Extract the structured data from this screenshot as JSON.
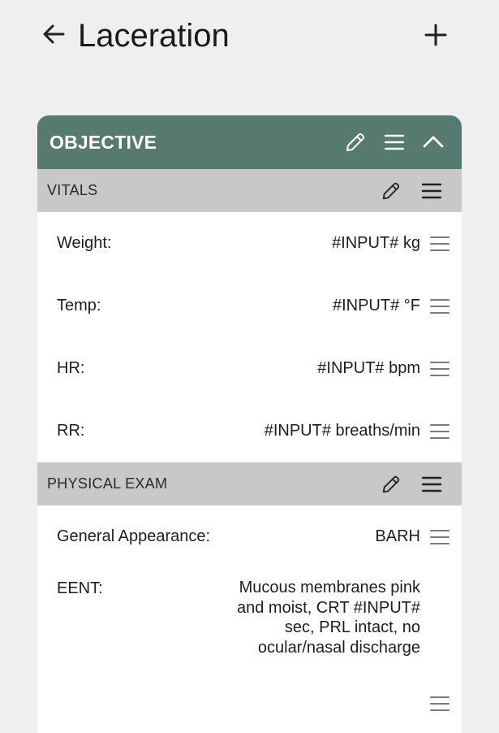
{
  "app_bar": {
    "title": "Laceration",
    "back_icon": "arrow-left-icon",
    "add_icon": "plus-icon"
  },
  "colors": {
    "background": "#efefef",
    "section_header": "#567a70",
    "subheader": "#c8c8c9",
    "card": "#ffffff",
    "icon": "#7a7a7a"
  },
  "section": {
    "title": "OBJECTIVE",
    "icons": [
      "pencil-icon",
      "menu-icon",
      "chevron-up-icon"
    ]
  },
  "subsections": [
    {
      "title": "VITALS",
      "rows": [
        {
          "label": "Weight:",
          "value": "#INPUT# kg"
        },
        {
          "label": "Temp:",
          "value": "#INPUT# °F"
        },
        {
          "label": "HR:",
          "value": "#INPUT# bpm"
        },
        {
          "label": "RR:",
          "value": "#INPUT# breaths/min"
        }
      ]
    },
    {
      "title": "PHYSICAL EXAM",
      "rows": [
        {
          "label": "General Appearance:",
          "value": "BARH"
        },
        {
          "label": "EENT:",
          "value": "Mucous membranes pink and moist, CRT #INPUT# sec, PRL intact, no ocular/nasal discharge"
        }
      ]
    }
  ]
}
